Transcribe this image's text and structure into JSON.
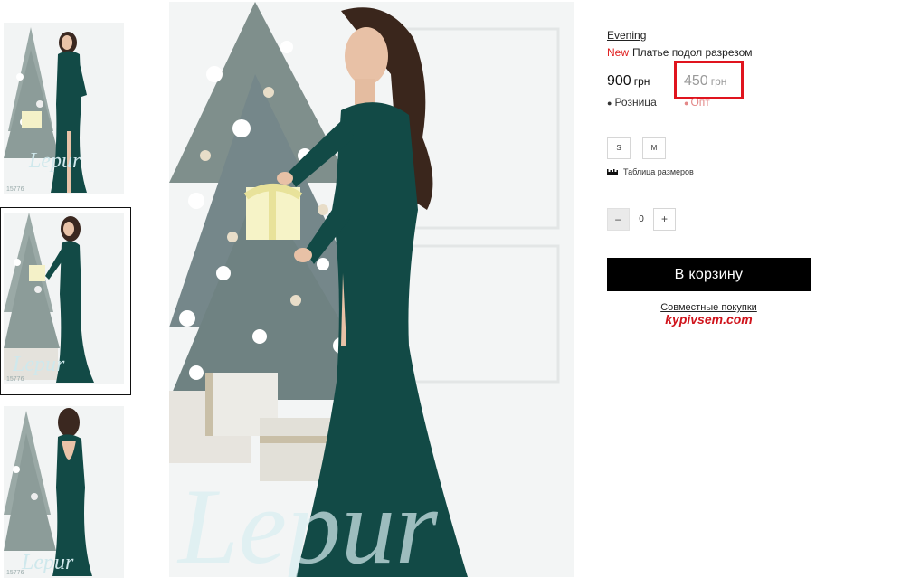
{
  "thumbnails": [
    {
      "code": "15776"
    },
    {
      "code": "15776"
    },
    {
      "code": "15776"
    }
  ],
  "product": {
    "brand": "Evening",
    "badge": "New",
    "title": "Платье подол разрезом",
    "price_retail": {
      "value": "900",
      "currency": "грн",
      "label": "Розница"
    },
    "price_wholesale": {
      "value": "450",
      "currency": "грн",
      "label": "Опт"
    },
    "sizes": [
      "S",
      "M"
    ],
    "size_chart_label": "Таблица размеров",
    "quantity": {
      "minus": "–",
      "value": "0",
      "plus": "+"
    },
    "add_to_cart": "В корзину",
    "joint_purchase": "Совместные покупки",
    "partner_logo": "kypivsem.com"
  },
  "colors": {
    "accent_red": "#e02020",
    "dress": "#124a46",
    "button_bg": "#000000"
  }
}
